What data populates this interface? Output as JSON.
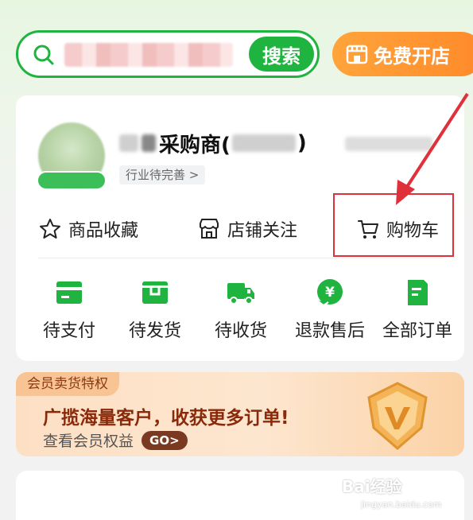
{
  "search": {
    "button_label": "搜索"
  },
  "open_shop": {
    "label": "免费开店"
  },
  "profile": {
    "name": "采购商(",
    "name_close": ")",
    "industry_tag": "行业待完善 >"
  },
  "shortcuts": [
    {
      "label": "商品收藏",
      "icon": "star-icon"
    },
    {
      "label": "店铺关注",
      "icon": "store-icon"
    },
    {
      "label": "购物车",
      "icon": "cart-icon"
    }
  ],
  "orders": [
    {
      "label": "待支付",
      "icon": "wallet-icon"
    },
    {
      "label": "待发货",
      "icon": "box-icon"
    },
    {
      "label": "待收货",
      "icon": "truck-icon"
    },
    {
      "label": "退款售后",
      "icon": "refund-icon"
    },
    {
      "label": "全部订单",
      "icon": "document-icon"
    }
  ],
  "banner": {
    "tag": "会员卖货特权",
    "title": "广揽海量客户，收获更多订单!",
    "subtitle": "查看会员权益",
    "go": "GO>"
  },
  "watermark": {
    "text": "Bai经验",
    "sub": "jingyan.baidu.com"
  },
  "colors": {
    "brand_green": "#1fb33f",
    "orange": "#ff8a2a",
    "highlight_red": "#e0303a"
  }
}
